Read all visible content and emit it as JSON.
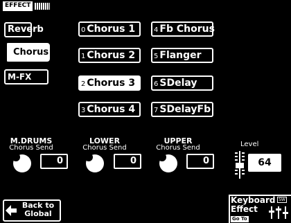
{
  "header": {
    "title": "EFFECT"
  },
  "tabs": [
    {
      "label": "Reverb",
      "selected": false
    },
    {
      "label": "Chorus",
      "selected": true
    },
    {
      "label": "M-FX",
      "selected": false
    }
  ],
  "chorus_types": [
    {
      "num": "0",
      "label": "Chorus 1",
      "selected": false
    },
    {
      "num": "1",
      "label": "Chorus 2",
      "selected": false
    },
    {
      "num": "2",
      "label": "Chorus 3",
      "selected": true
    },
    {
      "num": "3",
      "label": "Chorus 4",
      "selected": false
    },
    {
      "num": "4",
      "label": "Fb Chorus",
      "selected": false
    },
    {
      "num": "5",
      "label": "Flanger",
      "selected": false
    },
    {
      "num": "6",
      "label": "SDelay",
      "selected": false
    },
    {
      "num": "7",
      "label": "SDelayFb",
      "selected": false
    }
  ],
  "sends": [
    {
      "title": "M.DRUMS",
      "sub": "Chorus Send",
      "value": "0"
    },
    {
      "title": "LOWER",
      "sub": "Chorus Send",
      "value": "0"
    },
    {
      "title": "UPPER",
      "sub": "Chorus Send",
      "value": "0"
    }
  ],
  "level": {
    "label": "Level",
    "value": "64"
  },
  "back_button": {
    "line1": "Back to",
    "line2": "Global"
  },
  "keyboard_effect": {
    "line1": "Keyboard",
    "line2": "Effect",
    "goto": "Go To",
    "icon_text": "SW"
  },
  "colors": {
    "background": "#000000",
    "foreground": "#ffffff"
  }
}
